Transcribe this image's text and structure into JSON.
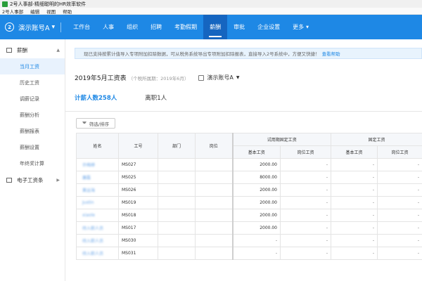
{
  "window": {
    "title": "2号人事部-精细聪明的HR效率软件"
  },
  "menubar": [
    "2号人事部",
    "编辑",
    "视图",
    "帮助"
  ],
  "topnav": {
    "logo_text": "2",
    "account": "演示账号A",
    "items": [
      "工作台",
      "人事",
      "组织",
      "招聘",
      "考勤假期",
      "薪酬",
      "审批",
      "企业设置",
      "更多"
    ],
    "active": "薪酬",
    "brand_color": "#1e88e5"
  },
  "sidebar": {
    "group1": "薪酬",
    "items": [
      "当月工资",
      "历史工资",
      "调薪记录",
      "薪酬分析",
      "薪酬报表",
      "薪酬设置",
      "年终奖计算"
    ],
    "active": "当月工资",
    "group2": "电子工资条"
  },
  "notice": {
    "text": "现已支持按累计值导入专项附加扣除数据，可从税务系统导出专项附加扣除报表，直接导入2号系统中，方便又快捷！",
    "link": "查看帮助"
  },
  "header": {
    "title": "2019年5月工资表",
    "subtitle": "（个税所属期：2019年6月）",
    "org": "演示账号A"
  },
  "stats": {
    "payroll_count": "计薪人数258人",
    "left_count": "离职1人"
  },
  "filter_button": "筛选/排序",
  "table": {
    "headers": {
      "name": "姓名",
      "id": "工号",
      "dept": "部门",
      "post": "岗位",
      "group_probation": "试用期固定工资",
      "group_fixed": "固定工资",
      "base": "基本工资",
      "post_pay": "岗位工资"
    },
    "rows": [
      {
        "name": "许梅婷",
        "id": "MS027",
        "dept": "",
        "post": "",
        "p_base": "2000.00",
        "p_post": "-",
        "f_base": "-",
        "f_post": "-"
      },
      {
        "name": "康磊",
        "id": "MS025",
        "dept": "",
        "post": "",
        "p_base": "8000.00",
        "p_post": "-",
        "f_base": "-",
        "f_post": "-"
      },
      {
        "name": "黄运海",
        "id": "MS026",
        "dept": "",
        "post": "",
        "p_base": "2000.00",
        "p_post": "-",
        "f_base": "-",
        "f_post": "-"
      },
      {
        "name": "Justin",
        "id": "MS019",
        "dept": "",
        "post": "",
        "p_base": "2000.00",
        "p_post": "-",
        "f_base": "-",
        "f_post": "-"
      },
      {
        "name": "xiaole",
        "id": "MS018",
        "dept": "",
        "post": "",
        "p_base": "2000.00",
        "p_post": "-",
        "f_base": "-",
        "f_post": "-"
      },
      {
        "name": "待入职人员",
        "id": "MS017",
        "dept": "",
        "post": "",
        "p_base": "2000.00",
        "p_post": "-",
        "f_base": "-",
        "f_post": "-"
      },
      {
        "name": "待入职人员",
        "id": "MS030",
        "dept": "",
        "post": "",
        "p_base": "-",
        "p_post": "-",
        "f_base": "-",
        "f_post": "-"
      },
      {
        "name": "待入职人员",
        "id": "MS031",
        "dept": "",
        "post": "",
        "p_base": "-",
        "p_post": "-",
        "f_base": "-",
        "f_post": "-"
      }
    ]
  }
}
